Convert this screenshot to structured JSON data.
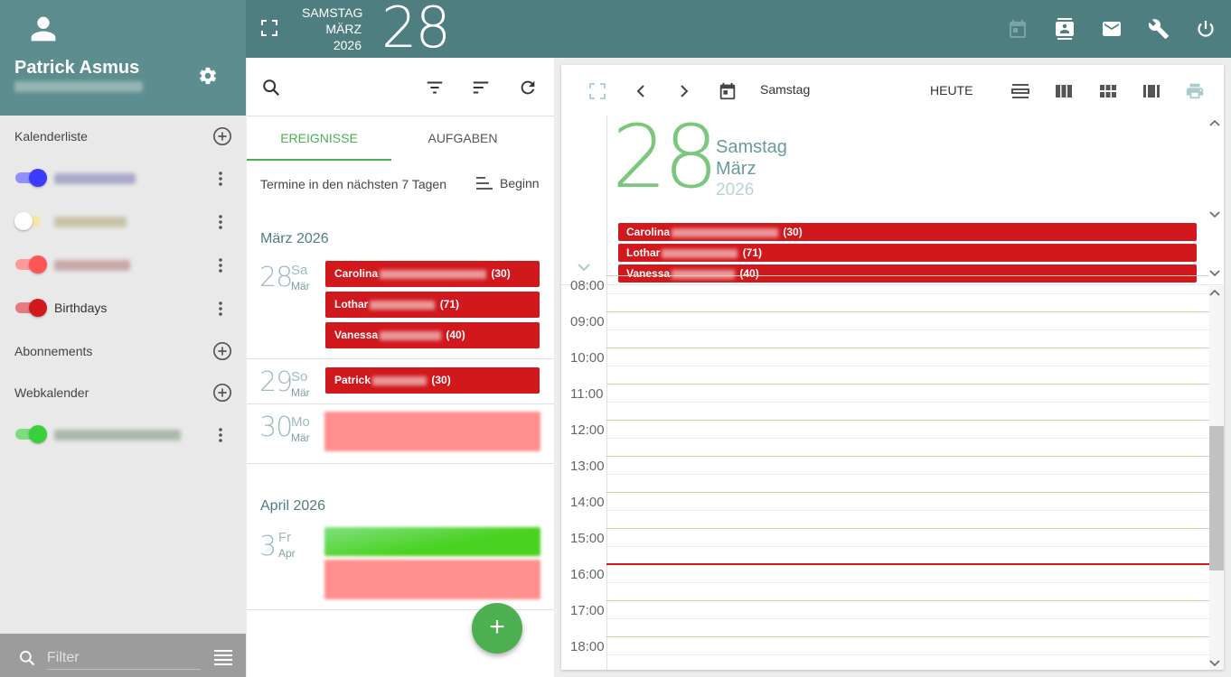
{
  "user": {
    "name": "Patrick Asmus"
  },
  "header": {
    "weekday": "SAMSTAG",
    "month": "MÄRZ",
    "year": "2026",
    "day": "28"
  },
  "sidebar": {
    "calendar_list_label": "Kalenderliste",
    "calendars": [
      {
        "name": "",
        "color": "#3b3bff"
      },
      {
        "name": "",
        "color": "#f5e6a8"
      },
      {
        "name": "",
        "color": "#ff5555"
      },
      {
        "name": "Birthdays",
        "color": "#d0181d"
      }
    ],
    "subscriptions_label": "Abonnements",
    "webcalendar_label": "Webkalender",
    "webcalendars": [
      {
        "name": "",
        "color": "#3ad03a"
      }
    ],
    "filter_placeholder": "Filter"
  },
  "middle": {
    "tabs": [
      {
        "label": "EREIGNISSE"
      },
      {
        "label": "AUFGABEN"
      }
    ],
    "range_text": "Termine in den nächsten 7 Tagen",
    "sort_label": "Beginn",
    "months": [
      {
        "label": "März 2026"
      },
      {
        "label": "April 2026"
      }
    ],
    "days": [
      {
        "num": "28",
        "weekday": "Sa",
        "month": "Mär",
        "events": [
          {
            "first": "Carolina",
            "age": "(30)"
          },
          {
            "first": "Lothar",
            "age": "(71)"
          },
          {
            "first": "Vanessa",
            "age": "(40)"
          }
        ]
      },
      {
        "num": "29",
        "weekday": "So",
        "month": "Mär",
        "events": [
          {
            "first": "Patrick",
            "age": "(30)"
          }
        ]
      },
      {
        "num": "30",
        "weekday": "Mo",
        "month": "Mär"
      },
      {
        "num": "3",
        "weekday": "Fr",
        "month": "Apr"
      }
    ],
    "fab_label": "+"
  },
  "right": {
    "day_label": "Samstag",
    "today_label": "HEUTE",
    "day_header": {
      "num": "28",
      "weekday": "Samstag",
      "month": "März",
      "year": "2026"
    },
    "allday_events": [
      {
        "first": "Carolina",
        "age": "(30)"
      },
      {
        "first": "Lothar",
        "age": "(71)"
      },
      {
        "first": "Vanessa",
        "age": "(40)"
      }
    ],
    "hours": [
      "08:00",
      "09:00",
      "10:00",
      "11:00",
      "12:00",
      "13:00",
      "14:00",
      "15:00",
      "16:00",
      "17:00",
      "18:00"
    ]
  },
  "colors": {
    "accent": "#4caf50",
    "header": "#4e7e7f",
    "birthday": "#d0181d"
  }
}
